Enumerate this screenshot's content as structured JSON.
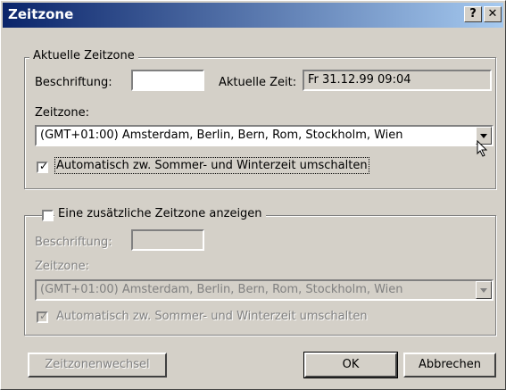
{
  "window": {
    "title": "Zeitzone",
    "help_glyph": "?",
    "close_glyph": "✕"
  },
  "current": {
    "group_label": "Aktuelle Zeitzone",
    "caption_label": "Beschriftung:",
    "caption_value": "",
    "time_label": "Aktuelle Zeit:",
    "time_value": "Fr 31.12.99 09:04",
    "zone_label": "Zeitzone:",
    "zone_value": "(GMT+01:00) Amsterdam, Berlin, Bern, Rom, Stockholm, Wien",
    "dst_label": "Automatisch zw. Sommer- und Winterzeit umschalten",
    "dst_checked": true
  },
  "additional": {
    "enable_label": "Eine zusätzliche Zeitzone anzeigen",
    "enable_checked": false,
    "caption_label": "Beschriftung:",
    "caption_value": "",
    "zone_label": "Zeitzone:",
    "zone_value": "(GMT+01:00) Amsterdam, Berlin, Bern, Rom, Stockholm, Wien",
    "dst_label": "Automatisch zw. Sommer- und Winterzeit umschalten",
    "dst_checked": true
  },
  "buttons": {
    "swap": "Zeitzonenwechsel",
    "ok": "OK",
    "cancel": "Abbrechen"
  },
  "colors": {
    "titlebar_start": "#0a246a",
    "titlebar_end": "#a6caf0",
    "face": "#d4d0c8"
  },
  "icons": {
    "help": "question-icon",
    "close": "close-icon",
    "dropdown": "chevron-down-icon",
    "check": "check-icon",
    "cursor": "pointer-cursor-icon"
  }
}
